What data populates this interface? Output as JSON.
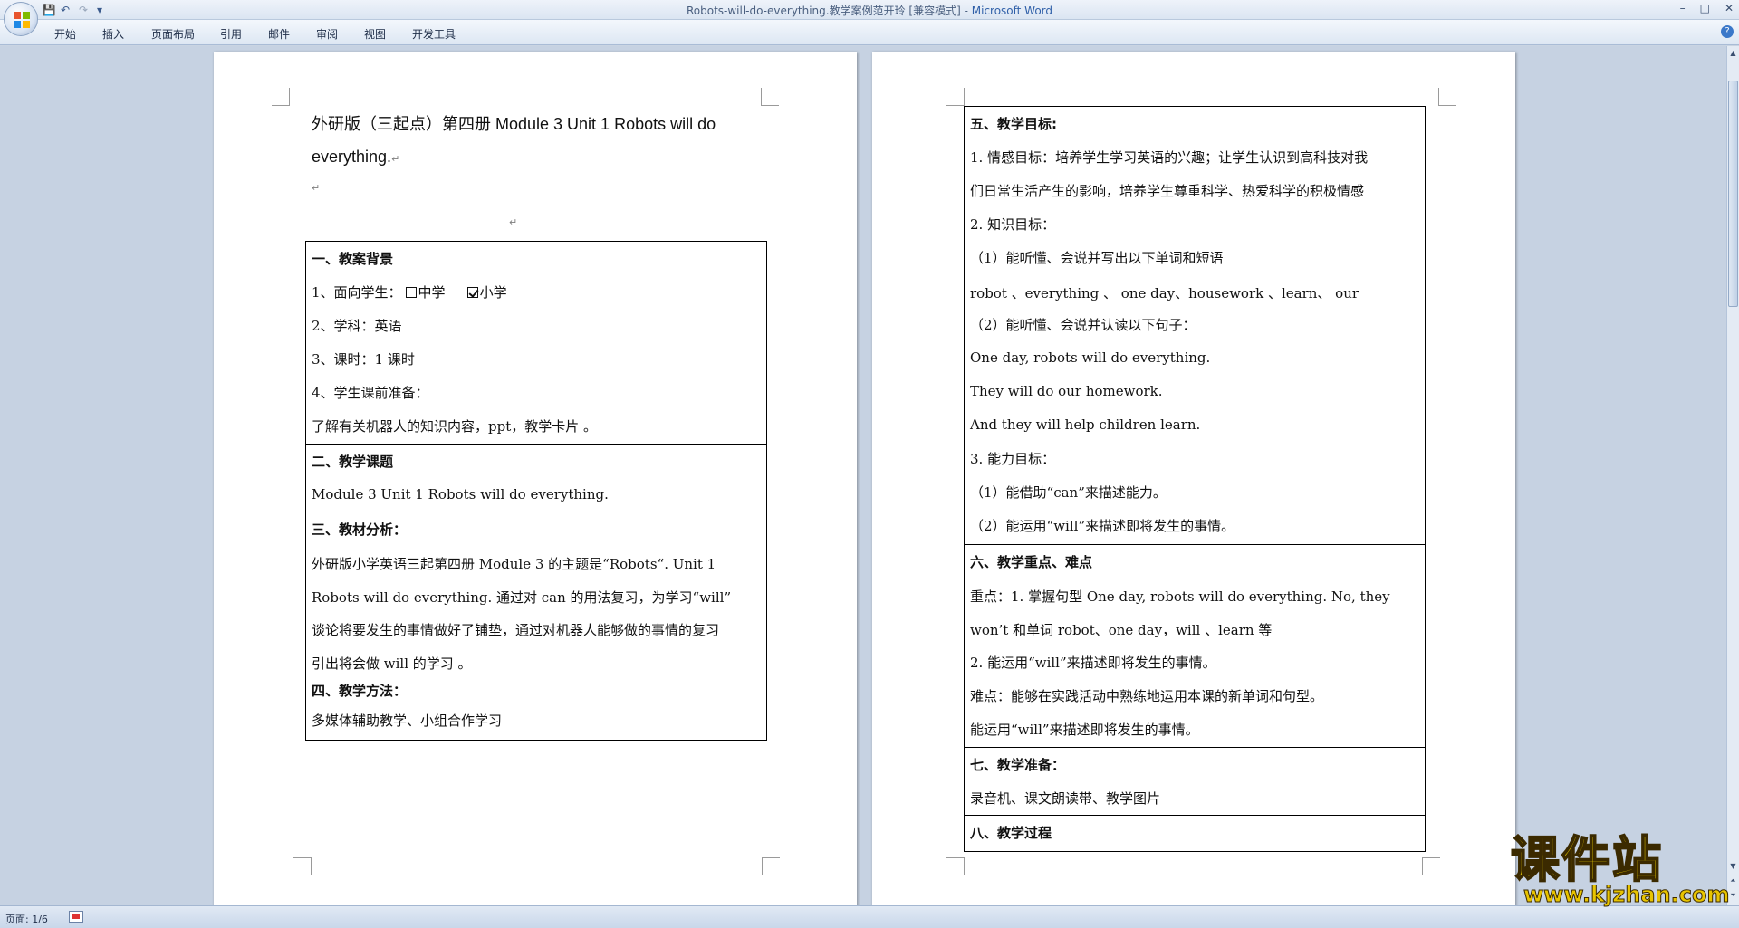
{
  "window": {
    "title": "Robots-will-do-everything.教学案例范开玲 [兼容模式]",
    "title_sep": " - ",
    "app_name": "Microsoft Word",
    "minimize": "–",
    "maximize": "□",
    "close": "✕"
  },
  "quick_access": {
    "save_icon": "💾",
    "undo_icon": "↶",
    "redo_icon": "↷",
    "customize_icon": "▾"
  },
  "ribbon": {
    "tabs": [
      "开始",
      "插入",
      "页面布局",
      "引用",
      "邮件",
      "审阅",
      "视图",
      "开发工具"
    ],
    "help": "?"
  },
  "page1": {
    "title_line1": "外研版（三起点）第四册 Module 3   Unit 1 Robots will do",
    "title_line2": "everything.",
    "para_mark": "↵",
    "sections": {
      "s1_heading": "一、教案背景",
      "s1_line1_prefix": "1、面向学生：",
      "s1_opt_middle": "中学",
      "s1_opt_primary": "小学",
      "s1_line2": "2、学科：英语",
      "s1_line3": "3、课时：1 课时",
      "s1_line4": "4、学生课前准备：",
      "s1_line5": "了解有关机器人的知识内容，ppt，教学卡片 。",
      "s2_heading": "二、教学课题",
      "s2_line1": "  Module 3   Unit 1           Robots will do everything.",
      "s3_heading": "三、教材分析：",
      "s3_line1": "外研版小学英语三起第四册 Module 3 的主题是“Robots“. Unit 1",
      "s3_line2": "Robots will do everything. 通过对 can 的用法复习，为学习“will”",
      "s3_line3": "谈论将要发生的事情做好了铺垫，通过对机器人能够做的事情的复习",
      "s3_line4": "引出将会做 will 的学习      。",
      "s4_heading": "四、教学方法：",
      "s4_line1": "多媒体辅助教学、小组合作学习"
    }
  },
  "page2": {
    "s5_heading": "五、教学目标:",
    "s5_line1": "1. 情感目标：培养学生学习英语的兴趣；让学生认识到高科技对我",
    "s5_line2": "们日常生活产生的影响，培养学生尊重科学、热爱科学的积极情感",
    "s5_line3": "2. 知识目标：",
    "s5_line4": "（1）能听懂、会说并写出以下单词和短语",
    "s5_line5": "robot 、everything 、 one day、housework 、learn、 our",
    "s5_line6": "（2）能听懂、会说并认读以下句子：",
    "s5_line7": "One day, robots will do everything.",
    "s5_line8": "They will do our homework.",
    "s5_line9": "And they will help children learn.",
    "s5_line10": "3. 能力目标：",
    "s5_line11": "（1）能借助“can”来描述能力。",
    "s5_line12": "（2）能运用“will”来描述即将发生的事情。",
    "s6_heading": "六、教学重点、难点",
    "s6_line1": "重点：1. 掌握句型 One day, robots will do everything. No, they",
    "s6_line2": "won’t 和单词 robot、one  day，will 、learn 等",
    "s6_line3": "        2. 能运用“will”来描述即将发生的事情。",
    "s6_line4": "难点：能够在实践活动中熟练地运用本课的新单词和句型。",
    "s6_line5": "        能运用“will”来描述即将发生的事情。",
    "s7_heading": "七、教学准备：",
    "s7_line1": "录音机、课文朗读带、教学图片",
    "s8_heading": "八、教学过程"
  },
  "statusbar": {
    "page_info": "页面: 1/6"
  },
  "watermark": {
    "text": "课件站",
    "url": "www.kjzhan.com"
  },
  "colors": {
    "ribbon_bg": "#dde7f3",
    "workspace_bg": "#c6d2e2",
    "watermark_yellow": "#f3d400"
  }
}
